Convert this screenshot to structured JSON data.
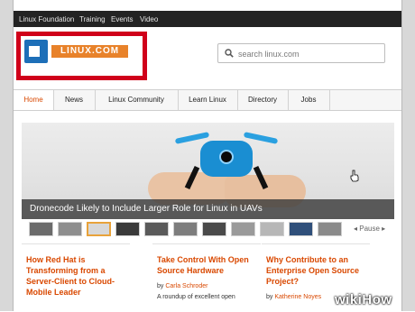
{
  "topbar": {
    "items": [
      "Linux Foundation",
      "Training",
      "Events",
      "Video"
    ]
  },
  "logo": {
    "text": "LINUX.COM"
  },
  "search": {
    "placeholder": "search linux.com"
  },
  "nav": {
    "tabs": [
      {
        "label": "Home",
        "active": true
      },
      {
        "label": "News",
        "active": false
      },
      {
        "label": "Linux Community",
        "active": false
      },
      {
        "label": "Learn Linux",
        "active": false
      },
      {
        "label": "Directory",
        "active": false
      },
      {
        "label": "Jobs",
        "active": false
      }
    ]
  },
  "hero": {
    "caption": "Dronecode Likely to Include Larger Role for Linux in UAVs"
  },
  "slideshow": {
    "pause_label": "◂ Pause ▸"
  },
  "articles": [
    {
      "title_lines": [
        "How Red Hat is",
        "Transforming from a",
        "Server-Client to Cloud-",
        "Mobile Leader"
      ],
      "by": "",
      "author": "",
      "excerpt": ""
    },
    {
      "title_lines": [
        "Take Control With Open",
        "Source Hardware"
      ],
      "by": "by",
      "author": "Carla Schroder",
      "excerpt": "A roundup of excellent open"
    },
    {
      "title_lines": [
        "Why Contribute to an",
        "Enterprise Open Source",
        "Project?"
      ],
      "by": "by",
      "author": "Katherine Noyes",
      "excerpt": ""
    }
  ],
  "watermark": {
    "wiki": "wiki",
    "how": "How"
  },
  "colors": {
    "accent": "#d94800",
    "topbar": "#232323",
    "logo_orange": "#e8822a",
    "logo_blue": "#1d6fb8",
    "highlight_red": "#d0001a"
  },
  "icons": {
    "search": "magnifier-icon",
    "cursor": "hand-pointer-icon"
  }
}
